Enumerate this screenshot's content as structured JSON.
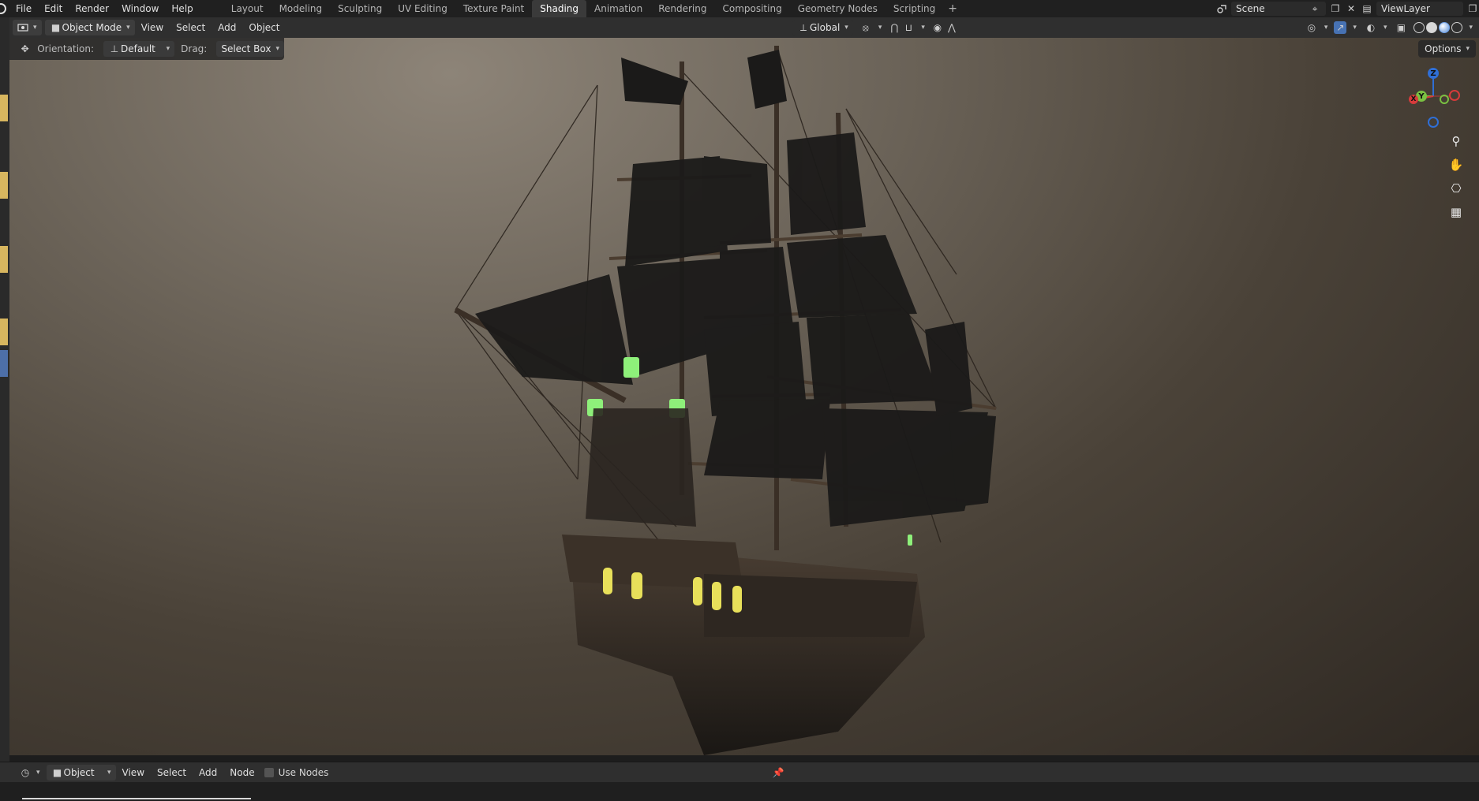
{
  "menu": [
    "File",
    "Edit",
    "Render",
    "Window",
    "Help"
  ],
  "workspaces": [
    "Layout",
    "Modeling",
    "Sculpting",
    "UV Editing",
    "Texture Paint",
    "Shading",
    "Animation",
    "Rendering",
    "Compositing",
    "Geometry Nodes",
    "Scripting"
  ],
  "active_workspace": "Shading",
  "scene": "Scene",
  "view_layer": "ViewLayer",
  "viewport_header": {
    "mode": "Object Mode",
    "menus": [
      "View",
      "Select",
      "Add",
      "Object"
    ],
    "transform_orientation": "Global"
  },
  "tool_header": {
    "orientation_label": "Orientation:",
    "orientation_value": "Default",
    "drag_label": "Drag:",
    "drag_value": "Select Box"
  },
  "options_label": "Options",
  "gizmo": {
    "z": "Z",
    "y": "Y",
    "x": "X"
  },
  "bottom_header": {
    "editor": "Object",
    "menus": [
      "View",
      "Select",
      "Add",
      "Node"
    ],
    "use_nodes": "Use Nodes"
  }
}
